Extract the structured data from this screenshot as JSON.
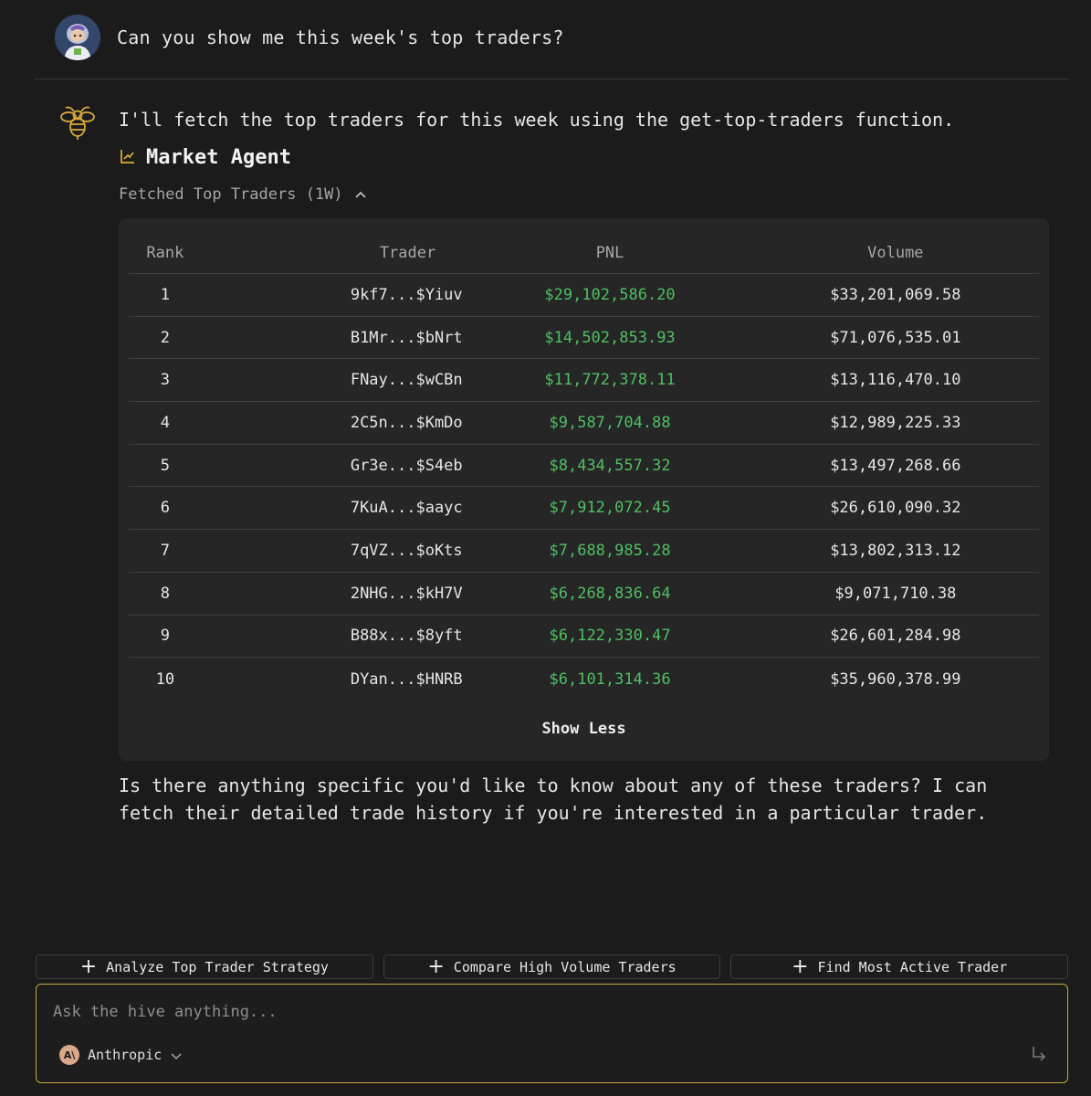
{
  "user_message": {
    "text": "Can you show me this week's top traders?"
  },
  "assistant": {
    "intro": "I'll fetch the top traders for this week using the get-top-traders function.",
    "agent_title": "Market Agent",
    "fetch_label": "Fetched Top Traders (1W)",
    "followup": "Is there anything specific you'd like to know about any of these traders? I can fetch their detailed trade history if you're interested in a particular trader."
  },
  "table": {
    "headers": {
      "rank": "Rank",
      "trader": "Trader",
      "pnl": "PNL",
      "volume": "Volume"
    },
    "rows": [
      {
        "rank": "1",
        "trader": "9kf7...$Yiuv",
        "pnl": "$29,102,586.20",
        "volume": "$33,201,069.58"
      },
      {
        "rank": "2",
        "trader": "B1Mr...$bNrt",
        "pnl": "$14,502,853.93",
        "volume": "$71,076,535.01"
      },
      {
        "rank": "3",
        "trader": "FNay...$wCBn",
        "pnl": "$11,772,378.11",
        "volume": "$13,116,470.10"
      },
      {
        "rank": "4",
        "trader": "2C5n...$KmDo",
        "pnl": "$9,587,704.88",
        "volume": "$12,989,225.33"
      },
      {
        "rank": "5",
        "trader": "Gr3e...$S4eb",
        "pnl": "$8,434,557.32",
        "volume": "$13,497,268.66"
      },
      {
        "rank": "6",
        "trader": "7KuA...$aayc",
        "pnl": "$7,912,072.45",
        "volume": "$26,610,090.32"
      },
      {
        "rank": "7",
        "trader": "7qVZ...$oKts",
        "pnl": "$7,688,985.28",
        "volume": "$13,802,313.12"
      },
      {
        "rank": "8",
        "trader": "2NHG...$kH7V",
        "pnl": "$6,268,836.64",
        "volume": "$9,071,710.38"
      },
      {
        "rank": "9",
        "trader": "B88x...$8yft",
        "pnl": "$6,122,330.47",
        "volume": "$26,601,284.98"
      },
      {
        "rank": "10",
        "trader": "DYan...$HNRB",
        "pnl": "$6,101,314.36",
        "volume": "$35,960,378.99"
      }
    ],
    "show_less_label": "Show Less"
  },
  "suggestions": [
    "Analyze Top Trader Strategy",
    "Compare High Volume Traders",
    "Find Most Active Trader"
  ],
  "input": {
    "placeholder": "Ask the hive anything...",
    "model_name": "Anthropic",
    "model_logo_text": "A\\"
  },
  "colors": {
    "background": "#1b1b1b",
    "card": "#262626",
    "accent": "#c8a440",
    "pnl_positive": "#4fbf63"
  },
  "icons": {
    "avatar": "astronaut-avatar",
    "assistant": "bee-icon",
    "agent": "chart-line-icon",
    "toggle": "chevron-up-icon",
    "suggestion": "plus-icon",
    "model_select": "chevron-down-icon",
    "send": "return-arrow-icon"
  }
}
